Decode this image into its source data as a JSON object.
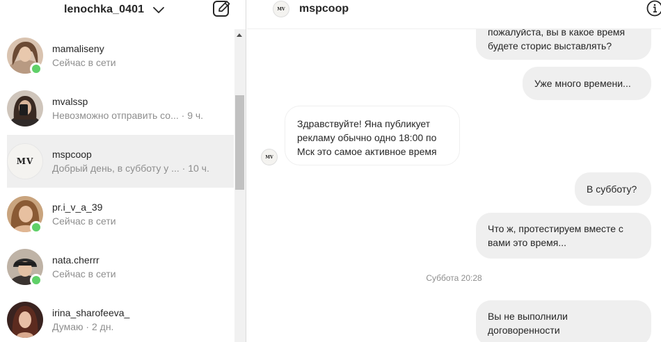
{
  "account": {
    "username": "lenochka_0401"
  },
  "conversations": [
    {
      "username": "mamaliseny",
      "status": "Сейчас в сети",
      "online": true,
      "active": false,
      "avatar": "photo-woman-1"
    },
    {
      "username": "mvalssp",
      "status": "Невозможно отправить со... · 9 ч.",
      "online": false,
      "active": false,
      "avatar": "photo-woman-2"
    },
    {
      "username": "mspcoop",
      "status": "Добрый день, в субботу у ... · 10 ч.",
      "online": false,
      "active": true,
      "avatar": "mv-logo",
      "logo_text": "MV"
    },
    {
      "username": "pr.i_v_a_39",
      "status": "Сейчас в сети",
      "online": true,
      "active": false,
      "avatar": "photo-woman-3"
    },
    {
      "username": "nata.cherrr",
      "status": "Сейчас в сети",
      "online": true,
      "active": false,
      "avatar": "photo-woman-4"
    },
    {
      "username": "irina_sharofeeva_",
      "status": "Думаю · 2 дн.",
      "online": false,
      "active": false,
      "avatar": "photo-woman-5"
    }
  ],
  "chat": {
    "title": "mspcoop",
    "logo_text": "MV",
    "messages": [
      {
        "from": "me",
        "text": "пожалуйста, вы в какое время будете сторис выставлять?"
      },
      {
        "from": "me",
        "text": "Уже много времени..."
      },
      {
        "from": "them",
        "text": "Здравствуйте! Яна публикует рекламу обычно одно 18:00 по Мск это самое активное время"
      },
      {
        "from": "me",
        "text": "В субботу?"
      },
      {
        "from": "me",
        "text": "Что ж, протестируем вместе с вами это время..."
      },
      {
        "from": "me",
        "text": "Вы не выполнили договоренности"
      }
    ],
    "timestamp": "Суббота 20:28"
  },
  "colors": {
    "online": "#5fd068",
    "bubble_out": "#efefef",
    "active_row": "#efefef",
    "muted_text": "#8e8e8e"
  },
  "icons": {
    "dropdown": "chevron-down-icon",
    "compose": "compose-icon",
    "info": "info-icon"
  }
}
